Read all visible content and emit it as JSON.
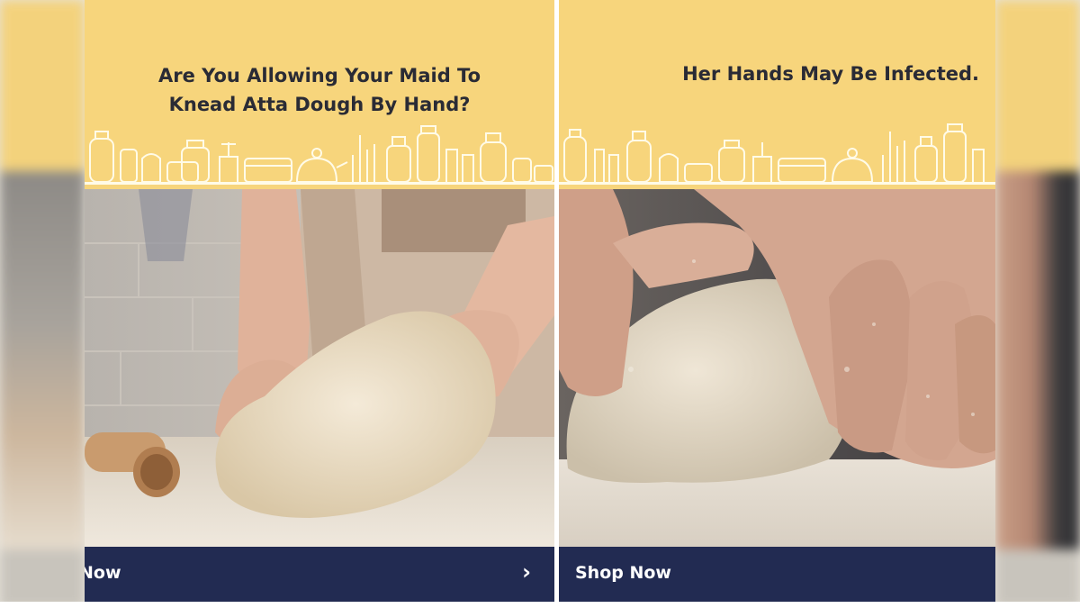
{
  "left_ad": {
    "headline_line1": "Are You Allowing Your Maid To",
    "headline_line2": "Knead Atta Dough By Hand?",
    "cta_label": "Now",
    "cta_icon": "chevron-right-icon"
  },
  "right_ad": {
    "headline": "Her Hands May Be Infected.",
    "cta_label": "Shop Now"
  },
  "colors": {
    "banner_yellow": "#f7d57c",
    "cta_bar": "#222b52",
    "headline_text": "#2a2b35"
  }
}
